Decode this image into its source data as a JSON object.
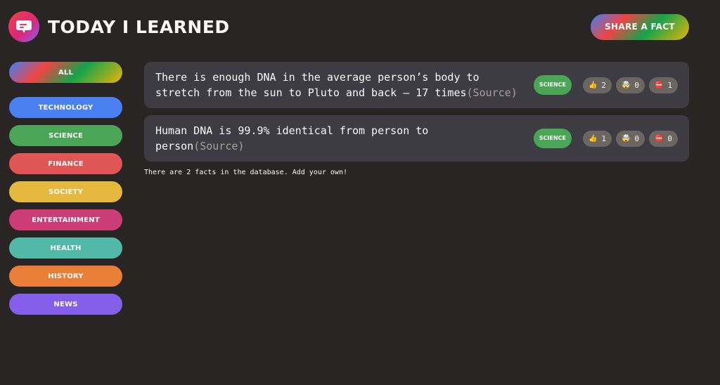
{
  "header": {
    "title": "Today I Learned",
    "share_label": "Share a fact"
  },
  "sidebar": {
    "categories": [
      {
        "label": "All",
        "color": "rainbow"
      },
      {
        "label": "Technology",
        "color": "#4a80ef"
      },
      {
        "label": "Science",
        "color": "#4aa556"
      },
      {
        "label": "Finance",
        "color": "#e05555"
      },
      {
        "label": "Society",
        "color": "#e4b93e"
      },
      {
        "label": "Entertainment",
        "color": "#cc3d78"
      },
      {
        "label": "Health",
        "color": "#52b8a8"
      },
      {
        "label": "History",
        "color": "#e97e38"
      },
      {
        "label": "News",
        "color": "#855ee9"
      }
    ]
  },
  "facts": [
    {
      "text": "There is enough DNA in the average person’s body to stretch from the sun to Pluto and back — 17 times",
      "source_label": "(Source)",
      "category": "Science",
      "votes": {
        "interesting": "2",
        "mindblowing": "0",
        "false": "1"
      }
    },
    {
      "text": "Human DNA is 99.9% identical from person to person",
      "source_label": "(Source)",
      "category": "Science",
      "votes": {
        "interesting": "1",
        "mindblowing": "0",
        "false": "0"
      }
    }
  ],
  "vote_icons": {
    "interesting": "👍",
    "mindblowing": "🤯",
    "false": "⛔"
  },
  "footer": {
    "count_text": "There are 2 facts in the database. Add your own!"
  }
}
